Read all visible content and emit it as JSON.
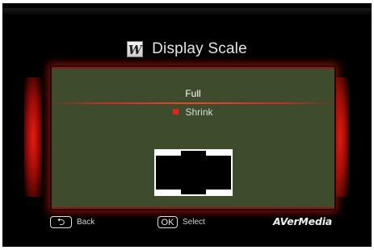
{
  "header": {
    "logo_letter": "W",
    "title": "Display Scale"
  },
  "menu": {
    "options": [
      {
        "label": "Full",
        "selected": true
      },
      {
        "label": "Shrink",
        "selected": false,
        "marker_color": "#e5231b"
      }
    ]
  },
  "footer": {
    "back_key_icon": "⮌",
    "back_label": "Back",
    "ok_key_label": "OK",
    "select_label": "Select",
    "brand": "AVerMedia"
  },
  "colors": {
    "panel_background": "#3f4b2d",
    "glow": "#e41d12",
    "background": "#000000"
  },
  "icons": {
    "logo": "w-logo-icon",
    "back": "return-arrow-icon",
    "preview": "scale-preview-icon"
  }
}
